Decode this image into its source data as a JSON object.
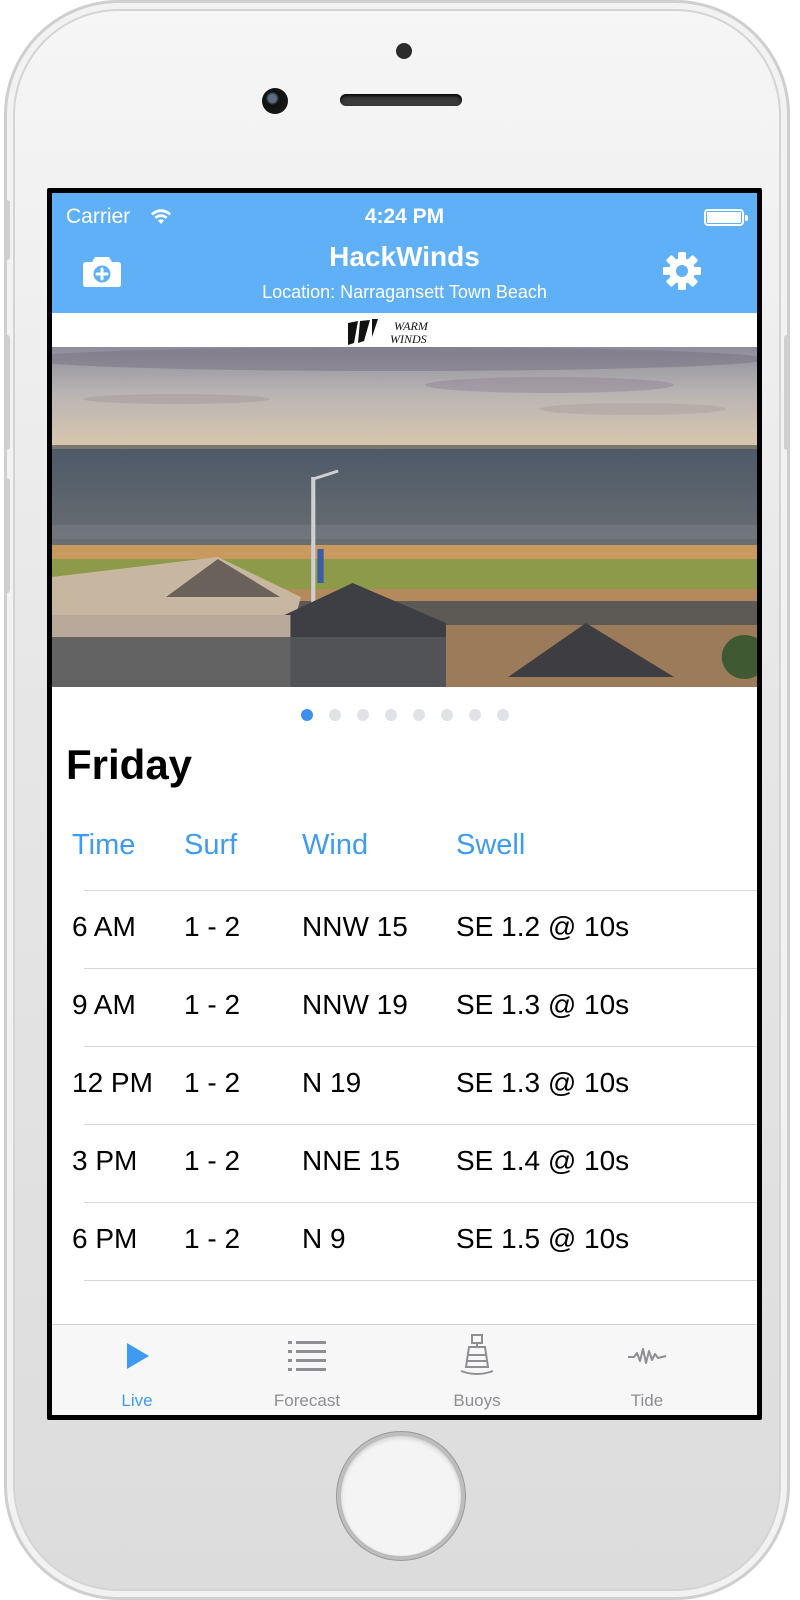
{
  "status_bar": {
    "carrier": "Carrier",
    "time": "4:24 PM"
  },
  "nav": {
    "title": "HackWinds",
    "subtitle": "Location: Narragansett Town Beach"
  },
  "webcam": {
    "logo_text": "WARM WINDS",
    "page_count": 8,
    "active_page": 0
  },
  "forecast": {
    "day": "Friday",
    "headers": [
      "Time",
      "Surf",
      "Wind",
      "Swell"
    ],
    "rows": [
      [
        "6 AM",
        "1 - 2",
        "NNW 15",
        "SE 1.2 @ 10s"
      ],
      [
        "9 AM",
        "1 - 2",
        "NNW 19",
        "SE 1.3 @ 10s"
      ],
      [
        "12 PM",
        "1 - 2",
        "N 19",
        "SE 1.3 @ 10s"
      ],
      [
        "3 PM",
        "1 - 2",
        "NNE 15",
        "SE 1.4 @ 10s"
      ],
      [
        "6 PM",
        "1 - 2",
        "N 9",
        "SE 1.5 @ 10s"
      ]
    ]
  },
  "tabs": [
    {
      "label": "Live",
      "icon": "play-icon",
      "active": true
    },
    {
      "label": "Forecast",
      "icon": "list-icon",
      "active": false
    },
    {
      "label": "Buoys",
      "icon": "buoy-icon",
      "active": false
    },
    {
      "label": "Tide",
      "icon": "wave-icon",
      "active": false
    }
  ],
  "colors": {
    "accent": "#3f9bf0",
    "navbar": "#5fb0f7"
  }
}
